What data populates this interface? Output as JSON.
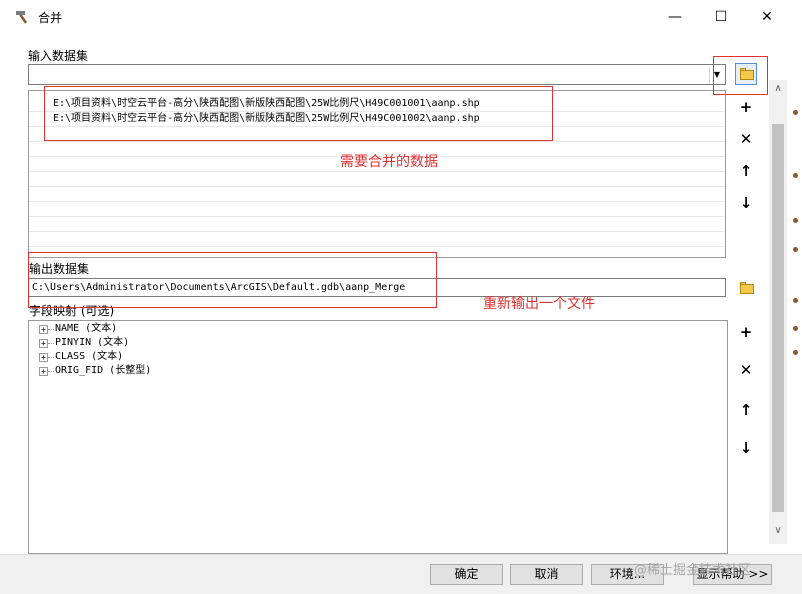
{
  "window": {
    "title": "合并",
    "minimize": "—",
    "maximize": "☐",
    "close": "✕"
  },
  "input": {
    "label": "输入数据集",
    "combo_value": "",
    "files": [
      "E:\\项目资料\\时空云平台-高分\\陕西配图\\新版陕西配图\\25W比例尺\\H49C001001\\aanp.shp",
      "E:\\项目资料\\时空云平台-高分\\陕西配图\\新版陕西配图\\25W比例尺\\H49C001002\\aanp.shp"
    ],
    "annotation": "需要合并的数据"
  },
  "output": {
    "label": "输出数据集",
    "value": "C:\\Users\\Administrator\\Documents\\ArcGIS\\Default.gdb\\aanp_Merge",
    "annotation": "重新输出一个文件"
  },
  "field_map": {
    "label": "字段映射 (可选)",
    "fields": [
      "NAME (文本)",
      "PINYIN (文本)",
      "CLASS (文本)",
      "ORIG_FID (长整型)"
    ]
  },
  "side_buttons": {
    "add": "+",
    "remove": "✕",
    "up": "↑",
    "down": "↓"
  },
  "footer": {
    "ok": "确定",
    "cancel": "取消",
    "env": "环境...",
    "help": "显示帮助 >>"
  },
  "watermark": "@稀土掘金技术社区",
  "accent": "#e03030"
}
